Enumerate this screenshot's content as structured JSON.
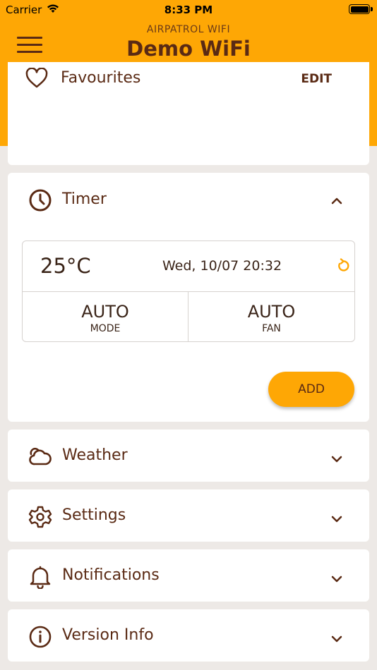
{
  "status_bar": {
    "carrier": "Carrier",
    "time": "8:33 PM"
  },
  "header": {
    "subtitle": "AIRPATROL WIFI",
    "title": "Demo WiFi"
  },
  "favourites": {
    "label": "Favourites",
    "edit_label": "EDIT"
  },
  "timer": {
    "label": "Timer",
    "entry": {
      "temperature": "25°C",
      "datetime": "Wed, 10/07 20:32",
      "mode_value": "AUTO",
      "mode_label": "MODE",
      "fan_value": "AUTO",
      "fan_label": "FAN"
    },
    "add_label": "ADD"
  },
  "sections": [
    {
      "label": "Weather",
      "icon": "cloud-icon"
    },
    {
      "label": "Settings",
      "icon": "gear-icon"
    },
    {
      "label": "Notifications",
      "icon": "bell-icon"
    },
    {
      "label": "Version Info",
      "icon": "info-icon"
    }
  ],
  "colors": {
    "accent": "#fea705",
    "text": "#5a2a14",
    "background": "#ede9e6"
  }
}
